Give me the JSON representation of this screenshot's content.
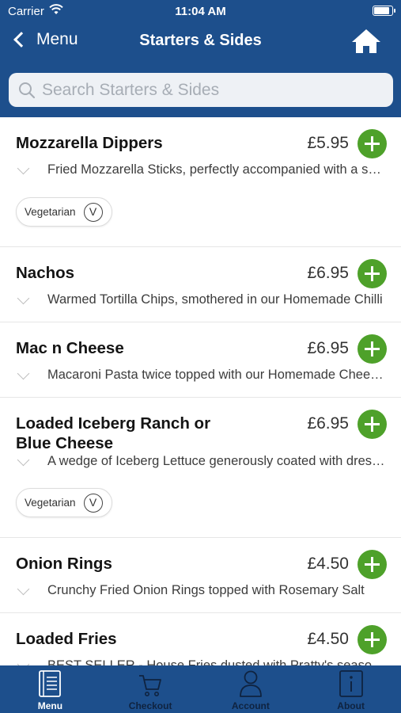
{
  "status_bar": {
    "carrier": "Carrier",
    "time": "11:04 AM"
  },
  "nav": {
    "back_label": "Menu",
    "title": "Starters & Sides"
  },
  "search": {
    "placeholder": "Search Starters & Sides",
    "value": ""
  },
  "items": [
    {
      "name": "Mozzarella Dippers",
      "price": "£5.95",
      "description": "Fried Mozzarella Sticks, perfectly accompanied with a sweet chilli dip",
      "tag": {
        "label": "Vegetarian",
        "symbol": "V"
      }
    },
    {
      "name": "Nachos",
      "price": "£6.95",
      "description": "Warmed Tortilla Chips, smothered in our Homemade Chilli"
    },
    {
      "name": "Mac n Cheese",
      "price": "£6.95",
      "description": "Macaroni Pasta twice topped with our Homemade Cheese Sauce"
    },
    {
      "name": "Loaded Iceberg Ranch or Blue Cheese",
      "price": "£6.95",
      "description": "A wedge of Iceberg Lettuce generously coated with dressing",
      "tag": {
        "label": "Vegetarian",
        "symbol": "V"
      }
    },
    {
      "name": "Onion Rings",
      "price": "£4.50",
      "description": "Crunchy Fried Onion Rings topped with Rosemary Salt"
    },
    {
      "name": "Loaded Fries",
      "price": "£4.50",
      "description": "BEST SELLER - House Fries dusted with Pratty's seasoning"
    }
  ],
  "tabbar": {
    "tabs": [
      {
        "label": "Menu",
        "icon": "menu-book-icon",
        "active": true
      },
      {
        "label": "Checkout",
        "icon": "cart-icon",
        "active": false
      },
      {
        "label": "Account",
        "icon": "person-icon",
        "active": false
      },
      {
        "label": "About",
        "icon": "info-icon",
        "active": false
      }
    ]
  },
  "colors": {
    "brand_blue": "#1d4f8c",
    "add_green": "#4ea12a",
    "inactive_tab_text": "#0f2340"
  }
}
